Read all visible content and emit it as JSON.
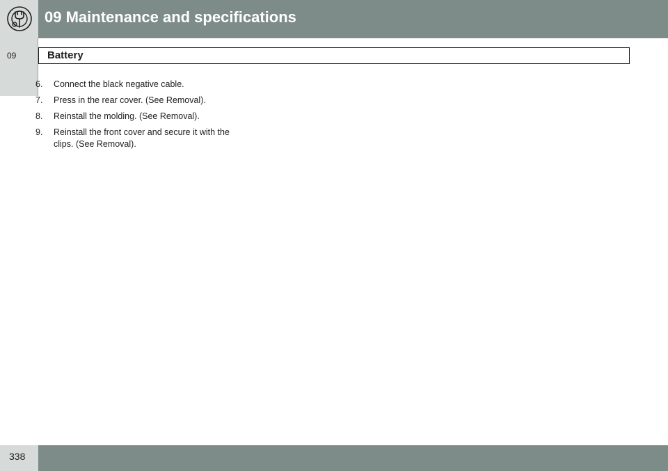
{
  "header": {
    "chapter_title": "09 Maintenance and specifications",
    "icon": "wrench-gear-icon"
  },
  "side_tab": {
    "label": "09"
  },
  "section": {
    "title": "Battery"
  },
  "steps": [
    {
      "number": "6.",
      "text": "Connect the black negative cable."
    },
    {
      "number": "7.",
      "text": "Press in the rear cover. (See Removal)."
    },
    {
      "number": "8.",
      "text": "Reinstall the molding. (See Removal)."
    },
    {
      "number": "9.",
      "text": "Reinstall the front cover and secure it with the clips. (See Removal)."
    }
  ],
  "footer": {
    "page_number": "338"
  },
  "colors": {
    "header_bar": "#7d8b89",
    "tab_background": "#d6dad9",
    "text": "#1e1e1e"
  }
}
